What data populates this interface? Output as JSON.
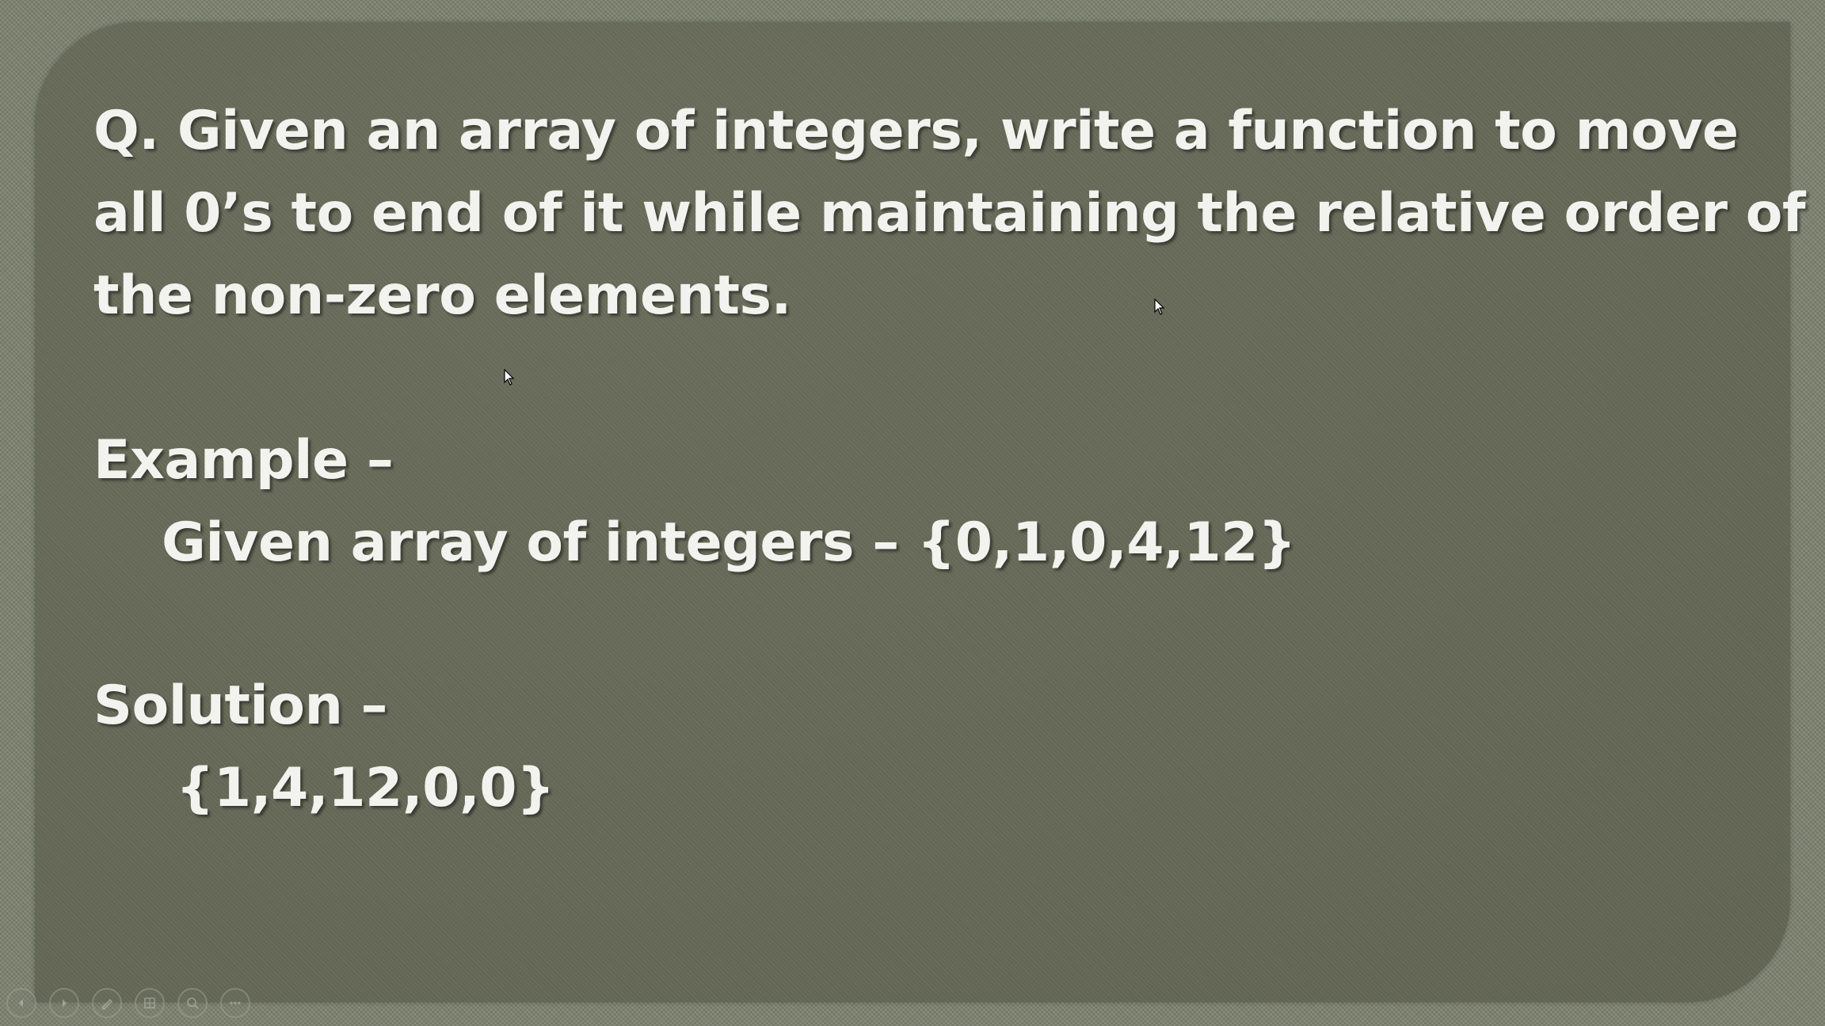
{
  "slide": {
    "question_lines": [
      "Q. Given an array of integers, write a function to move",
      "all 0’s to end of it while maintaining the relative order of",
      "the non-zero elements."
    ],
    "example_heading": "Example –",
    "example_line": "Given array of integers – {0,1,0,4,12}",
    "solution_heading": "Solution –",
    "solution_line": "{1,4,12,0,0}"
  },
  "toolbar": {
    "icons": [
      "previous-slide-icon",
      "next-slide-icon",
      "pen-icon",
      "slides-grid-icon",
      "zoom-icon",
      "more-options-icon"
    ]
  },
  "colors": {
    "background": "#7d826f",
    "panel": "#666957",
    "text": "#f2f2ee"
  }
}
